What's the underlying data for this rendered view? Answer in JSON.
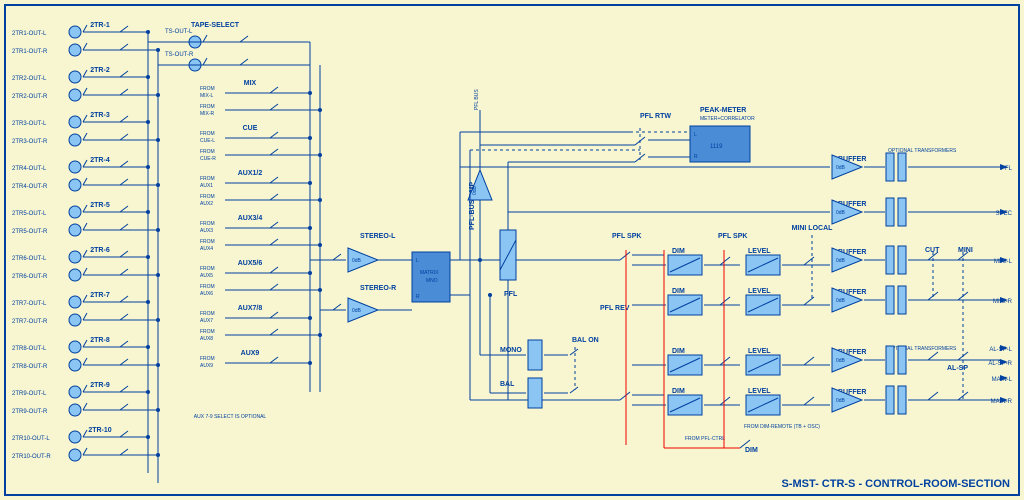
{
  "title": "S-MST- CTR-S - CONTROL-ROOM-SECTION",
  "tracks": [
    {
      "name": "2TR-1",
      "outL": "2TR1-OUT-L",
      "outR": "2TR1-OUT-R"
    },
    {
      "name": "2TR-2",
      "outL": "2TR2-OUT-L",
      "outR": "2TR2-OUT-R"
    },
    {
      "name": "2TR-3",
      "outL": "2TR3-OUT-L",
      "outR": "2TR3-OUT-R"
    },
    {
      "name": "2TR-4",
      "outL": "2TR4-OUT-L",
      "outR": "2TR4-OUT-R"
    },
    {
      "name": "2TR-5",
      "outL": "2TR5-OUT-L",
      "outR": "2TR5-OUT-R"
    },
    {
      "name": "2TR-6",
      "outL": "2TR6-OUT-L",
      "outR": "2TR6-OUT-R"
    },
    {
      "name": "2TR-7",
      "outL": "2TR7-OUT-L",
      "outR": "2TR7-OUT-R"
    },
    {
      "name": "2TR-8",
      "outL": "2TR8-OUT-L",
      "outR": "2TR8-OUT-R"
    },
    {
      "name": "2TR-9",
      "outL": "2TR9-OUT-L",
      "outR": "2TR9-OUT-R"
    },
    {
      "name": "2TR-10",
      "outL": "2TR10-OUT-L",
      "outR": "2TR10-OUT-R"
    }
  ],
  "tape_select": {
    "label": "TAPE-SELECT",
    "outL": "TS-OUT-L",
    "outR": "TS-OUT-R"
  },
  "sources": [
    {
      "label": "MIX",
      "fromL": "FROM MIX-L",
      "fromR": "FROM MIX-R"
    },
    {
      "label": "CUE",
      "fromL": "FROM CUE-L",
      "fromR": "FROM CUE-R"
    },
    {
      "label": "AUX1/2",
      "fromL": "FROM AUX1",
      "fromR": "FROM AUX2"
    },
    {
      "label": "AUX3/4",
      "fromL": "FROM AUX3",
      "fromR": "FROM AUX4"
    },
    {
      "label": "AUX5/6",
      "fromL": "FROM AUX5",
      "fromR": "FROM AUX6"
    },
    {
      "label": "AUX7/8",
      "fromL": "FROM AUX7",
      "fromR": "FROM AUX8"
    },
    {
      "label": "AUX9",
      "fromL": "FROM AUX9",
      "fromR": ""
    }
  ],
  "aux_note": "AUX 7-9 SELECT IS OPTIONAL",
  "stereo": {
    "L": "STEREO-L",
    "R": "STEREO-R",
    "gain": "0dB"
  },
  "matrix": {
    "label": "MATRIX",
    "sub": "MNO",
    "L": "L",
    "R": "R"
  },
  "pfl": {
    "label": "PFL",
    "bus_amp": "PFL-BUS-AMP",
    "bus_note": "PFL BUS",
    "rtw": "PFL RTW",
    "spk": "PFL SPK",
    "rev": "PFL REV",
    "ctrl": "FROM PFL-CTRL",
    "gain": "0dB"
  },
  "mono": {
    "label": "MONO",
    "bal": "BAL",
    "bal_on": "BAL ON"
  },
  "peak": {
    "label": "PEAK-METER",
    "sub": "METER+CORRELATOR",
    "model": "1119",
    "L": "L",
    "R": "R"
  },
  "dim": {
    "label": "DIM",
    "remote": "FROM DIM-REMOTE (TB + OSC)"
  },
  "level": "LEVEL",
  "mini_local": "MINI LOCAL",
  "buffer": "BUFFER",
  "buffer_gain": "0dB",
  "opt_trans": "OPTIONAL TRANSFORMERS",
  "cut": "CUT",
  "mini": "MINI",
  "alsp": "AL-SP",
  "outputs": {
    "pfl": "PFL",
    "spec": "SPEC",
    "miniL": "MINI-L",
    "miniR": "MINI-R",
    "alspL": "AL-SP-L",
    "alspR": "AL-SP-R",
    "mainL": "MAIN-L",
    "mainR": "MAIN-R"
  }
}
